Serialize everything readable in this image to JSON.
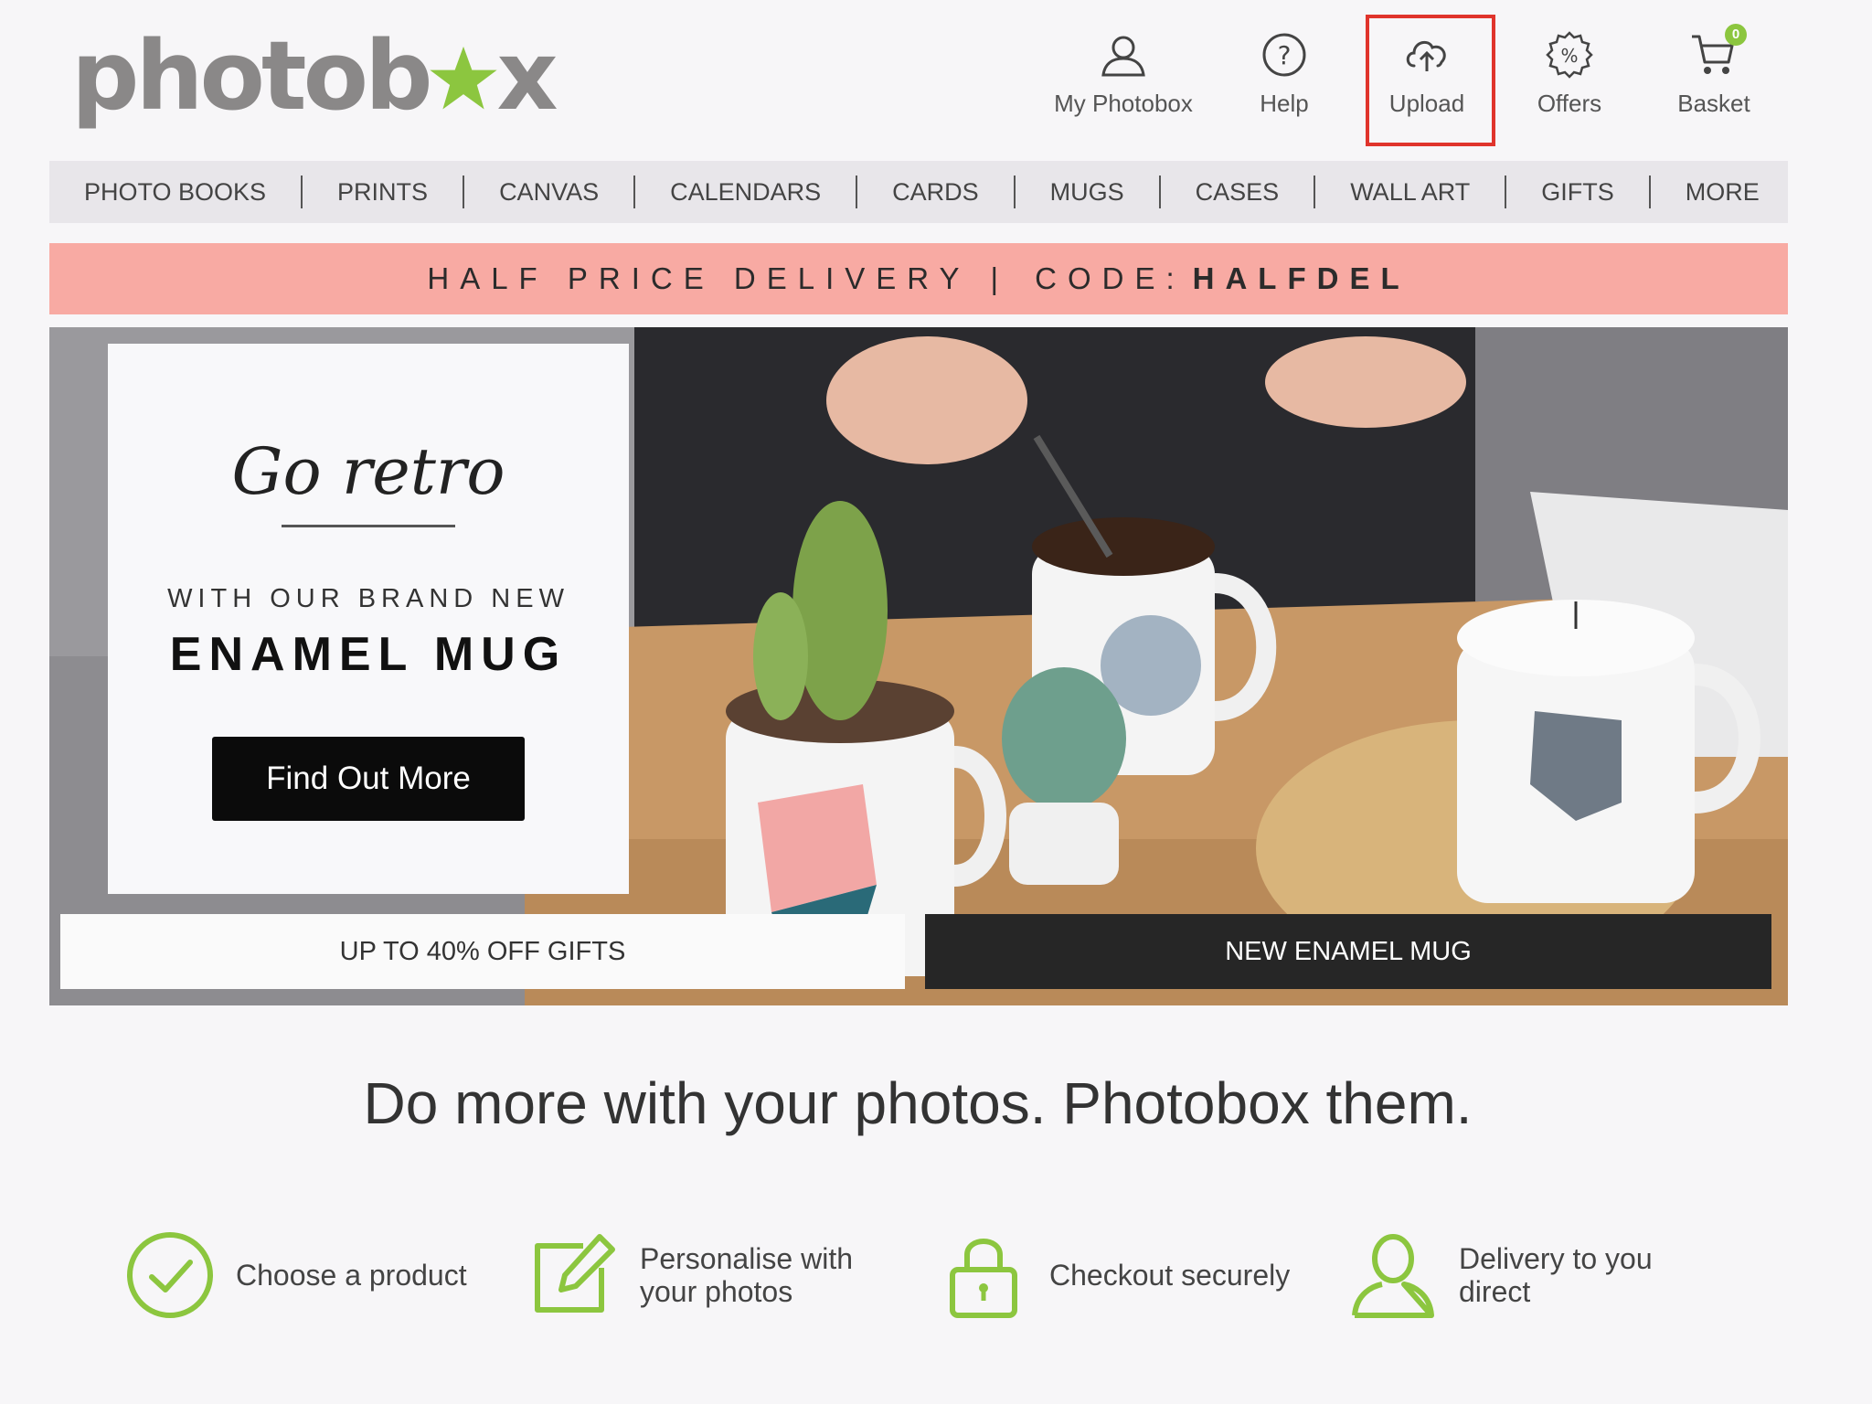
{
  "brand": {
    "logo_text_before": "photob",
    "logo_text_after": "x",
    "accent": "#8cc63f",
    "logo_color": "#8a8888"
  },
  "header": {
    "nav": [
      {
        "label": "My Photobox",
        "icon": "user-icon"
      },
      {
        "label": "Help",
        "icon": "help-icon"
      },
      {
        "label": "Upload",
        "icon": "cloud-upload-icon"
      },
      {
        "label": "Offers",
        "icon": "offers-badge-icon"
      },
      {
        "label": "Basket",
        "icon": "basket-icon",
        "count": "0"
      }
    ],
    "highlight_color": "#e0342c"
  },
  "categories": [
    "PHOTO BOOKS",
    "PRINTS",
    "CANVAS",
    "CALENDARS",
    "CARDS",
    "MUGS",
    "CASES",
    "WALL ART",
    "GIFTS",
    "MORE"
  ],
  "promo": {
    "text": "HALF PRICE DELIVERY",
    "separator": "|",
    "code_label": "CODE:",
    "code": "HALFDEL",
    "background": "#f8aaa3"
  },
  "hero": {
    "title": "Go retro",
    "subtitle": "WITH OUR BRAND NEW",
    "product": "ENAMEL MUG",
    "cta": "Find Out More",
    "tile_left": "UP TO 40% OFF GIFTS",
    "tile_right": "NEW ENAMEL MUG"
  },
  "tagline": "Do more with your photos. Photobox them.",
  "steps": [
    {
      "label": "Choose a product",
      "icon": "check-circle-icon"
    },
    {
      "label_line1": "Personalise with",
      "label_line2": "your photos",
      "icon": "edit-icon"
    },
    {
      "label": "Checkout securely",
      "icon": "padlock-icon"
    },
    {
      "label_line1": "Delivery to you",
      "label_line2": "direct",
      "icon": "person-icon"
    }
  ]
}
